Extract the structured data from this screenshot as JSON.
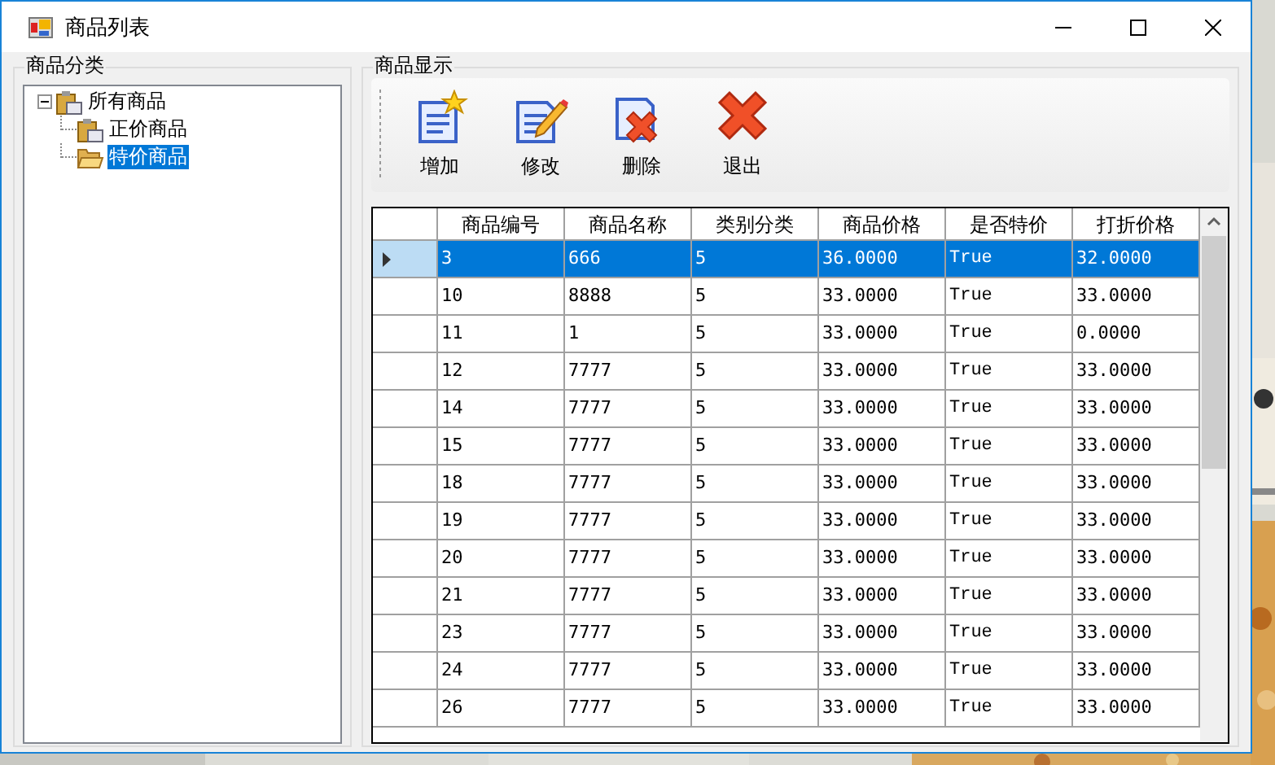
{
  "window": {
    "title": "商品列表"
  },
  "category_group": {
    "title": "商品分类",
    "tree": [
      {
        "label": "所有商品",
        "expanded": true,
        "selected": false,
        "kind": "folder",
        "children": [
          {
            "label": "正价商品",
            "selected": false,
            "kind": "folder"
          },
          {
            "label": "特价商品",
            "selected": true,
            "kind": "open"
          }
        ]
      }
    ]
  },
  "display_group": {
    "title": "商品显示",
    "toolbar": [
      {
        "kind": "add",
        "label": "增加"
      },
      {
        "kind": "edit",
        "label": "修改"
      },
      {
        "kind": "delete",
        "label": "删除"
      },
      {
        "kind": "exit",
        "label": "退出"
      }
    ],
    "table": {
      "columns": [
        "商品编号",
        "商品名称",
        "类别分类",
        "商品价格",
        "是否特价",
        "打折价格"
      ],
      "rows": [
        {
          "selected": true,
          "cells": [
            "3",
            "666",
            "5",
            "36.0000",
            "True",
            "32.0000"
          ]
        },
        {
          "selected": false,
          "cells": [
            "10",
            "8888",
            "5",
            "33.0000",
            "True",
            "33.0000"
          ]
        },
        {
          "selected": false,
          "cells": [
            "11",
            "1",
            "5",
            "33.0000",
            "True",
            "0.0000"
          ]
        },
        {
          "selected": false,
          "cells": [
            "12",
            "7777",
            "5",
            "33.0000",
            "True",
            "33.0000"
          ]
        },
        {
          "selected": false,
          "cells": [
            "14",
            "7777",
            "5",
            "33.0000",
            "True",
            "33.0000"
          ]
        },
        {
          "selected": false,
          "cells": [
            "15",
            "7777",
            "5",
            "33.0000",
            "True",
            "33.0000"
          ]
        },
        {
          "selected": false,
          "cells": [
            "18",
            "7777",
            "5",
            "33.0000",
            "True",
            "33.0000"
          ]
        },
        {
          "selected": false,
          "cells": [
            "19",
            "7777",
            "5",
            "33.0000",
            "True",
            "33.0000"
          ]
        },
        {
          "selected": false,
          "cells": [
            "20",
            "7777",
            "5",
            "33.0000",
            "True",
            "33.0000"
          ]
        },
        {
          "selected": false,
          "cells": [
            "21",
            "7777",
            "5",
            "33.0000",
            "True",
            "33.0000"
          ]
        },
        {
          "selected": false,
          "cells": [
            "23",
            "7777",
            "5",
            "33.0000",
            "True",
            "33.0000"
          ]
        },
        {
          "selected": false,
          "cells": [
            "24",
            "7777",
            "5",
            "33.0000",
            "True",
            "33.0000"
          ]
        },
        {
          "selected": false,
          "cells": [
            "26",
            "7777",
            "5",
            "33.0000",
            "True",
            "33.0000"
          ]
        }
      ]
    }
  }
}
